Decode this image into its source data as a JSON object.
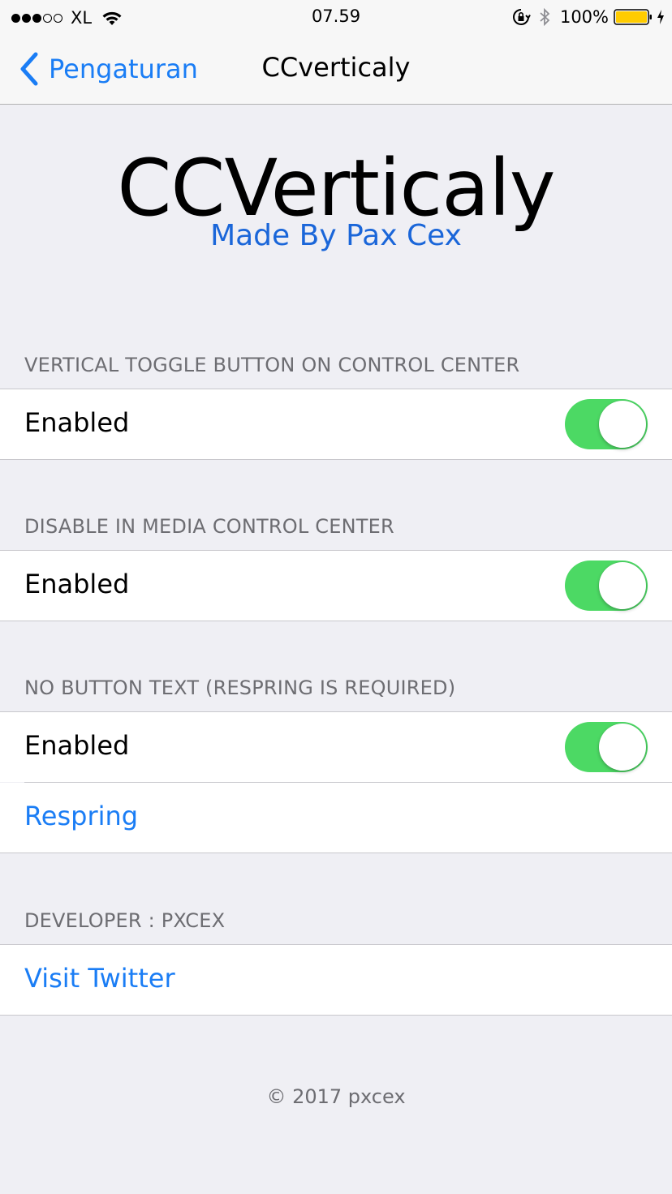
{
  "status_bar": {
    "carrier": "XL",
    "time": "07.59",
    "battery_percent": "100%",
    "battery_color": "#ffcc00",
    "signal_bars_filled": 3,
    "signal_bars_total": 5
  },
  "nav": {
    "back_label": "Pengaturan",
    "title": "CCverticaly"
  },
  "header": {
    "title": "CCVerticaly",
    "subtitle": "Made By Pax Cex"
  },
  "sections": [
    {
      "header": "VERTICAL TOGGLE BUTTON ON CONTROL CENTER",
      "rows": [
        {
          "label": "Enabled",
          "toggle_on": true
        }
      ]
    },
    {
      "header": "DISABLE IN MEDIA CONTROL CENTER",
      "rows": [
        {
          "label": "Enabled",
          "toggle_on": true
        }
      ]
    },
    {
      "header": "NO BUTTON TEXT (RESPRING IS REQUIRED)",
      "rows": [
        {
          "label": "Enabled",
          "toggle_on": true
        },
        {
          "link": "Respring"
        }
      ]
    },
    {
      "header": "DEVELOPER : PXCEX",
      "rows": [
        {
          "link": "Visit Twitter"
        }
      ]
    }
  ],
  "footer": "© 2017 pxcex",
  "colors": {
    "accent": "#1a7df5",
    "toggle_on": "#4cd964",
    "subtitle": "#1a66d9",
    "background": "#efeff4"
  },
  "icons": [
    "wifi-icon",
    "rotation-lock-icon",
    "bluetooth-icon",
    "battery-icon",
    "charging-bolt-icon",
    "back-chevron-icon"
  ]
}
